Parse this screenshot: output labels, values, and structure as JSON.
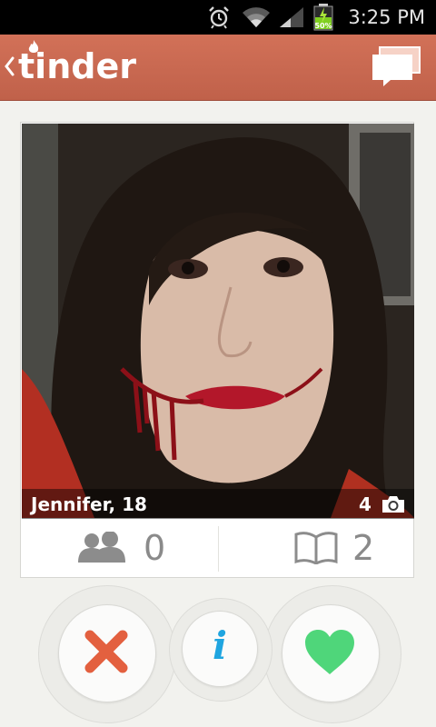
{
  "status_bar": {
    "time": "3:25 PM",
    "battery_percent": "50%",
    "icons": [
      "alarm-icon",
      "wifi-icon",
      "signal-icon",
      "battery-icon"
    ]
  },
  "action_bar": {
    "logo_text": "tinder",
    "back_icon": "chevron-left-icon",
    "chat_icon": "chat-bubbles-icon",
    "background_color": "#c9674e"
  },
  "profile": {
    "name_age": "Jennifer, 18",
    "photo_count": "4",
    "photo_icon": "camera-icon",
    "photo_description_icon": "profile-photo"
  },
  "stats": {
    "shared_friends": "0",
    "shared_interests": "2",
    "friends_icon": "friends-icon",
    "interests_icon": "book-icon"
  },
  "actions": {
    "dislike_icon": "x-icon",
    "info_label": "i",
    "like_icon": "heart-icon",
    "dislike_color": "#e3603f",
    "info_color": "#1fa5e0",
    "like_color": "#4fd67a"
  }
}
